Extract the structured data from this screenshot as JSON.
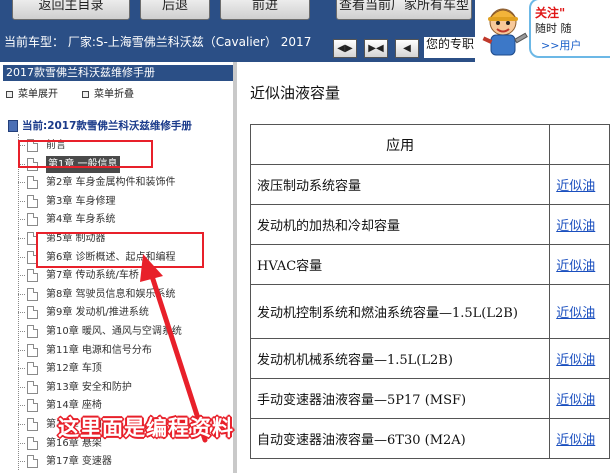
{
  "toolbar": {
    "buttons": [
      "返回主目录",
      "后退",
      "前进",
      "查看当前厂家所有车型"
    ]
  },
  "promo": {
    "line1": "关注\"",
    "line2": "随时 随",
    "line3": ">>用户"
  },
  "vehicle_bar": {
    "text": "当前车型： 厂家:S-上海雪佛兰科沃兹（Cavalier） 2017",
    "nav_buttons": [
      "◀▶",
      "▶◀",
      "◀"
    ],
    "pro_label": "您的专职"
  },
  "left_panel": {
    "manual_title": "2017款雪佛兰科沃兹维修手册",
    "expand_all": "菜单展开",
    "collapse_all": "菜单折叠",
    "tree_root": "当前:2017款雪佛兰科沃兹维修手册",
    "items": [
      "前言",
      "第1章 一般信息",
      "第2章 车身金属构件和装饰件",
      "第3章 车身修理",
      "第4章 车身系统",
      "第5章 制动器",
      "第6章 诊断概述、起点和编程",
      "第7章 传动系统/车桥",
      "第8章 驾驶员信息和娱乐系统",
      "第9章 发动机/推进系统",
      "第10章 暖风、通风与空调系统",
      "第11章 电源和信号分布",
      "第12章 车顶",
      "第13章 安全和防护",
      "第14章 座椅",
      "第15章 转向系统",
      "第16章 悬架",
      "第17章 变速器"
    ],
    "selected_index": 1
  },
  "annotation": {
    "text": "这里面是编程资料"
  },
  "content": {
    "title": "近似油液容量",
    "table_header": [
      "应用",
      ""
    ],
    "rows": [
      [
        "液压制动系统容量",
        "近似油"
      ],
      [
        "发动机的加热和冷却容量",
        "近似油"
      ],
      [
        "HVAC容量",
        "近似油"
      ],
      [
        "发动机控制系统和燃油系统容量—1.5L(L2B)",
        "近似油"
      ],
      [
        "发动机机械系统容量—1.5L(L2B)",
        "近似油"
      ],
      [
        "手动变速器油液容量—5P17 (MSF)",
        "近似油"
      ],
      [
        "自动变速器油液容量—6T30 (M2A)",
        "近似油"
      ]
    ]
  },
  "colors": {
    "header_blue": "#2b4f86",
    "annotation_red": "#e8202a",
    "link_blue": "#1a4fbf"
  }
}
